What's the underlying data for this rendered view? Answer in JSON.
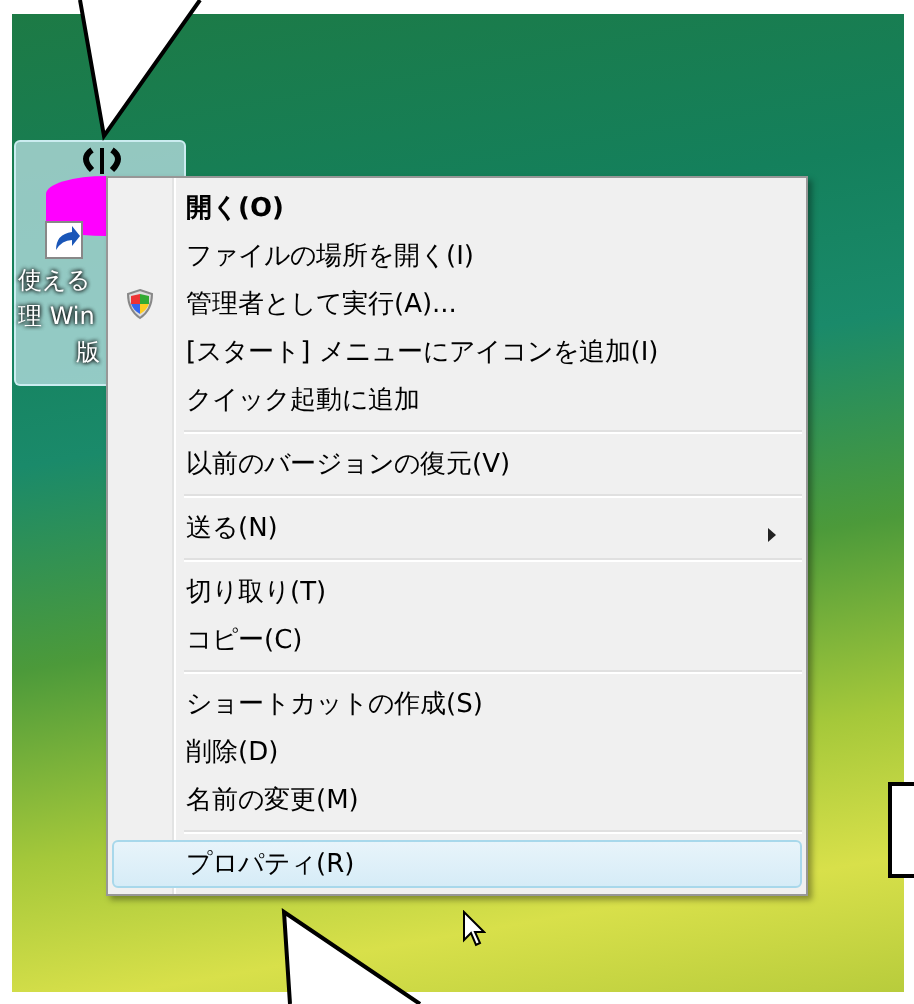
{
  "desktop_icon": {
    "selected": true,
    "label_lines": [
      "使える",
      "理 Win",
      "版"
    ]
  },
  "context_menu": {
    "groups": [
      [
        {
          "label": "開く(O)",
          "kind": "default",
          "selected": false
        },
        {
          "label": "ファイルの場所を開く(I)",
          "kind": "plain",
          "selected": false
        },
        {
          "label": "管理者として実行(A)...",
          "kind": "shield",
          "selected": false
        },
        {
          "label": "[スタート] メニューにアイコンを追加(I)",
          "kind": "plain",
          "selected": false
        },
        {
          "label": "クイック起動に追加",
          "kind": "plain",
          "selected": false
        }
      ],
      [
        {
          "label": "以前のバージョンの復元(V)",
          "kind": "plain",
          "selected": false
        }
      ],
      [
        {
          "label": "送る(N)",
          "kind": "submenu",
          "selected": false
        }
      ],
      [
        {
          "label": "切り取り(T)",
          "kind": "plain",
          "selected": false
        },
        {
          "label": "コピー(C)",
          "kind": "plain",
          "selected": false
        }
      ],
      [
        {
          "label": "ショートカットの作成(S)",
          "kind": "plain",
          "selected": false
        },
        {
          "label": "削除(D)",
          "kind": "plain",
          "selected": false
        },
        {
          "label": "名前の変更(M)",
          "kind": "plain",
          "selected": false
        }
      ],
      [
        {
          "label": "プロパティ(R)",
          "kind": "plain",
          "selected": true
        }
      ]
    ]
  }
}
